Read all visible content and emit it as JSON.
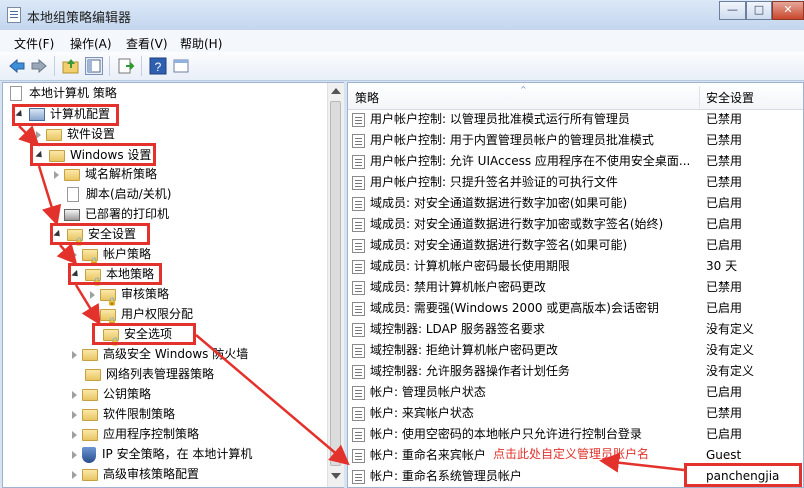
{
  "window": {
    "title": "本地组策略编辑器",
    "buttons": [
      "—",
      "□",
      "✕"
    ]
  },
  "menu": [
    "文件(F)",
    "操作(A)",
    "查看(V)",
    "帮助(H)"
  ],
  "toolbar": {
    "icons": [
      "back-icon",
      "forward-icon",
      "up-folder-icon",
      "show-hide-tree-icon",
      "export-list-icon",
      "help-icon",
      "properties-icon"
    ]
  },
  "tree": {
    "root": "本地计算机 策略",
    "computer_config": "计算机配置",
    "software_settings": "软件设置",
    "windows_settings": "Windows 设置",
    "dns_policy": "域名解析策略",
    "scripts": "脚本(启动/关机)",
    "deployed_printers": "已部署的打印机",
    "security_settings": "安全设置",
    "account_policies": "帐户策略",
    "local_policies": "本地策略",
    "audit_policy": "审核策略",
    "user_rights": "用户权限分配",
    "security_options": "安全选项",
    "firewall": "高级安全 Windows 防火墙",
    "network_list": "网络列表管理器策略",
    "public_key": "公钥策略",
    "software_restriction": "软件限制策略",
    "app_control": "应用程序控制策略",
    "ipsec": "IP 安全策略，在 本地计算机",
    "advanced_audit": "高级审核策略配置"
  },
  "list": {
    "col_policy": "策略",
    "col_setting": "安全设置",
    "rows": [
      {
        "policy": "用户帐户控制: 以管理员批准模式运行所有管理员",
        "setting": "已禁用"
      },
      {
        "policy": "用户帐户控制: 用于内置管理员帐户的管理员批准模式",
        "setting": "已禁用"
      },
      {
        "policy": "用户帐户控制: 允许 UIAccess 应用程序在不使用安全桌面...",
        "setting": "已禁用"
      },
      {
        "policy": "用户帐户控制: 只提升签名并验证的可执行文件",
        "setting": "已禁用"
      },
      {
        "policy": "域成员: 对安全通道数据进行数字加密(如果可能)",
        "setting": "已启用"
      },
      {
        "policy": "域成员: 对安全通道数据进行数字加密或数字签名(始终)",
        "setting": "已启用"
      },
      {
        "policy": "域成员: 对安全通道数据进行数字签名(如果可能)",
        "setting": "已启用"
      },
      {
        "policy": "域成员: 计算机帐户密码最长使用期限",
        "setting": "30 天"
      },
      {
        "policy": "域成员: 禁用计算机帐户密码更改",
        "setting": "已禁用"
      },
      {
        "policy": "域成员: 需要强(Windows 2000 或更高版本)会话密钥",
        "setting": "已启用"
      },
      {
        "policy": "域控制器: LDAP 服务器签名要求",
        "setting": "没有定义"
      },
      {
        "policy": "域控制器: 拒绝计算机帐户密码更改",
        "setting": "没有定义"
      },
      {
        "policy": "域控制器: 允许服务器操作者计划任务",
        "setting": "没有定义"
      },
      {
        "policy": "帐户: 管理员帐户状态",
        "setting": "已启用"
      },
      {
        "policy": "帐户: 来宾帐户状态",
        "setting": "已禁用"
      },
      {
        "policy": "帐户: 使用空密码的本地帐户只允许进行控制台登录",
        "setting": "已启用"
      },
      {
        "policy": "帐户: 重命名来宾帐户",
        "setting": "Guest"
      },
      {
        "policy": "帐户: 重命名系统管理员帐户",
        "setting": "panchengjia"
      }
    ]
  },
  "annotation": {
    "text": "点击此处自定义管理员账户名",
    "color": "#e3322b"
  }
}
